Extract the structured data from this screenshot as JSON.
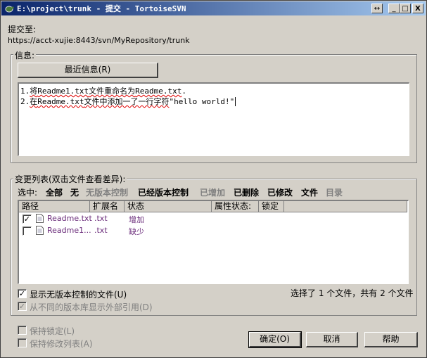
{
  "window": {
    "title": "E:\\project\\trunk - 提交 - TortoiseSVN",
    "buttons": {
      "resize": "↔",
      "minimize": "_",
      "maximize": "□",
      "close": "X"
    }
  },
  "commit_to": {
    "label": "提交至:",
    "url": "https://acct-xujie:8443/svn/MyRepository/trunk"
  },
  "message": {
    "group_label": "信息:",
    "recent_button": "最近信息(R)",
    "lines": [
      [
        "1.",
        "将",
        "Readme1.txt",
        "文件重命名为",
        "Readme.txt",
        "."
      ],
      [
        "2.",
        "在",
        "Readme.txt",
        "文件中添加一了一行字符",
        "\"hello world!\"",
        ""
      ]
    ]
  },
  "changes": {
    "group_label": "变更列表(双击文件查看差异):",
    "select_label": "选中:",
    "filters": [
      {
        "label": "全部",
        "enabled": true
      },
      {
        "label": "无",
        "enabled": true
      },
      {
        "label": "无版本控制",
        "enabled": false
      },
      {
        "label": "已经版本控制",
        "enabled": true
      },
      {
        "label": "已增加",
        "enabled": false
      },
      {
        "label": "已删除",
        "enabled": true
      },
      {
        "label": "已修改",
        "enabled": true
      },
      {
        "label": "文件",
        "enabled": true
      },
      {
        "label": "目录",
        "enabled": false
      }
    ],
    "columns": [
      "路径",
      "扩展名",
      "状态",
      "属性状态:",
      "锁定"
    ],
    "rows": [
      {
        "checked": true,
        "path": "Readme.txt",
        "ext": ".txt",
        "status": "增加"
      },
      {
        "checked": false,
        "path": "Readme1...",
        "ext": ".txt",
        "status": "缺少"
      }
    ],
    "show_unversioned": {
      "label": "显示无版本控制的文件(U)",
      "checked": true
    },
    "show_externals": {
      "label": "从不同的版本库显示外部引用(D)",
      "checked": true
    },
    "selection_summary": "选择了 1 个文件，共有 2 个文件"
  },
  "options": {
    "keep_locks": "保持锁定(L)",
    "keep_changelists": "保持修改列表(A)"
  },
  "actions": {
    "ok": "确定(O)",
    "cancel": "取消",
    "help": "帮助"
  }
}
